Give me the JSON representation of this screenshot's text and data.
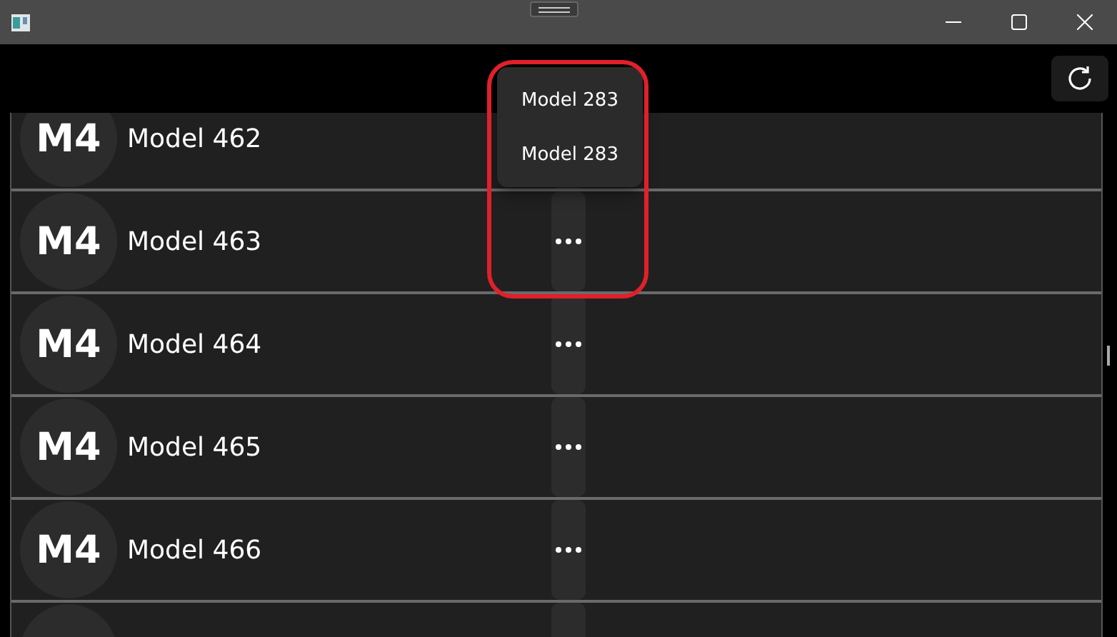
{
  "toolbar": {
    "refresh": {
      "kind": "refresh"
    }
  },
  "rows": [
    {
      "avatar": "M4",
      "name": "Model 462"
    },
    {
      "avatar": "M4",
      "name": "Model 463"
    },
    {
      "avatar": "M4",
      "name": "Model 464"
    },
    {
      "avatar": "M4",
      "name": "Model 465"
    },
    {
      "avatar": "M4",
      "name": "Model 466"
    }
  ],
  "flyout": {
    "open": true,
    "items": [
      "Model 283",
      "Model 283"
    ],
    "highlighted": true
  }
}
